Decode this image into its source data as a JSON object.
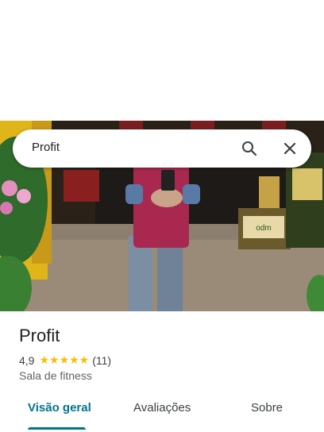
{
  "search": {
    "query": "Profit"
  },
  "place": {
    "name": "Profit",
    "rating": "4,9",
    "stars": "★★★★★",
    "review_count": "(11)",
    "category": "Sala de fitness"
  },
  "tabs": [
    {
      "label": "Visão geral",
      "active": true
    },
    {
      "label": "Avaliações",
      "active": false
    },
    {
      "label": "Sobre",
      "active": false
    }
  ],
  "photo_sign": "odm",
  "colors": {
    "accent": "#00758a",
    "star": "#fbbc04"
  },
  "icons": [
    "search-icon",
    "close-icon"
  ]
}
